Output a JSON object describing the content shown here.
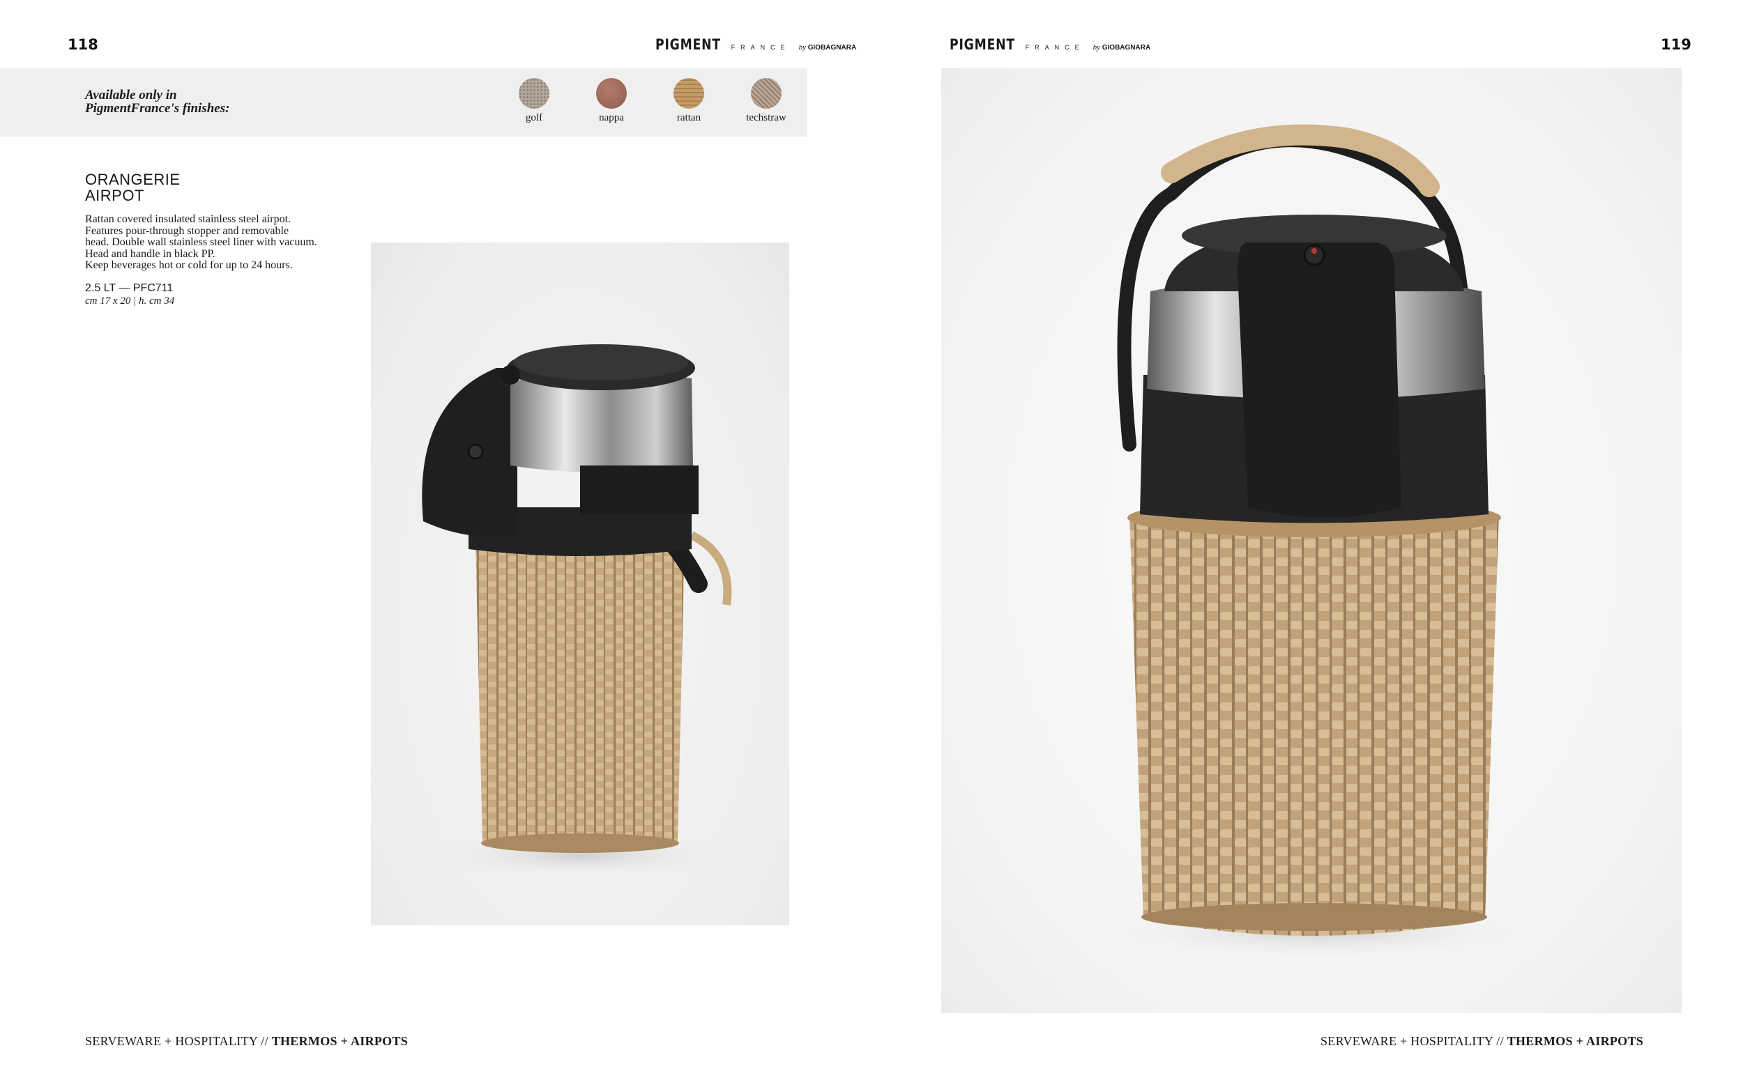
{
  "left_page": {
    "page_number": "118",
    "brand": {
      "main": "PIGMENT",
      "sub": "FRANCE",
      "by": "by",
      "maker": "GIOBAGNARA"
    },
    "finishes": {
      "intro_line1": "Available only in",
      "intro_line2": "PigmentFrance's finishes:",
      "items": [
        {
          "label": "golf",
          "color": "#9a8a7e"
        },
        {
          "label": "nappa",
          "color": "#9c6a5a"
        },
        {
          "label": "rattan",
          "color": "#d9c09a"
        },
        {
          "label": "techstraw",
          "color": "#a89484"
        }
      ]
    },
    "product": {
      "title_line1": "ORANGERIE",
      "title_line2": "AIRPOT",
      "description": [
        "Rattan covered insulated stainless steel airpot.",
        "Features pour-through stopper and removable",
        "head. Double wall stainless steel liner with vacuum.",
        "Head and handle in black PP.",
        "Keep beverages hot or cold for up to 24 hours."
      ],
      "code": "2.5 LT — PFC711",
      "dimensions": "cm 17 x 20  |  h. cm 34"
    },
    "footer": {
      "section": "SERVEWARE + HOSPITALITY // ",
      "category": "THERMOS + AIRPOTS"
    }
  },
  "right_page": {
    "page_number": "119",
    "brand": {
      "main": "PIGMENT",
      "sub": "FRANCE",
      "by": "by",
      "maker": "GIOBAGNARA"
    },
    "footer": {
      "section": "SERVEWARE + HOSPITALITY // ",
      "category": "THERMOS + AIRPOTS"
    }
  },
  "colors": {
    "band": "#efefef",
    "rattan": "#c4a57e",
    "rattan_dark": "#9c7f5b",
    "plastic_black": "#1f1f1f",
    "steel": "#a9a9a9"
  }
}
